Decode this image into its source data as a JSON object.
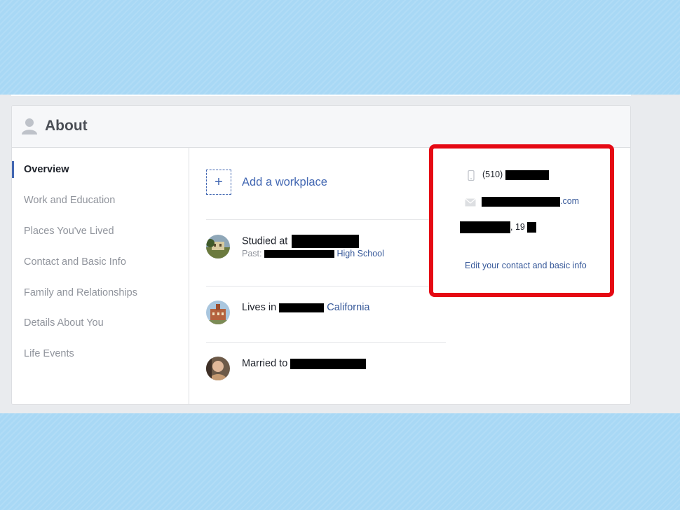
{
  "page": {
    "colors": {
      "accent": "#4267b2",
      "link": "#365899",
      "highlight_box": "#e50914",
      "background": "#a8d8f5"
    }
  },
  "about": {
    "title": "About",
    "icon": "person-icon"
  },
  "sidebar": {
    "items": [
      {
        "label": "Overview",
        "active": true
      },
      {
        "label": "Work and Education",
        "active": false
      },
      {
        "label": "Places You've Lived",
        "active": false
      },
      {
        "label": "Contact and Basic Info",
        "active": false
      },
      {
        "label": "Family and Relationships",
        "active": false
      },
      {
        "label": "Details About You",
        "active": false
      },
      {
        "label": "Life Events",
        "active": false
      }
    ]
  },
  "overview": {
    "add_workplace": {
      "icon": "plus-icon",
      "label": "Add a workplace"
    },
    "education": {
      "prefix": "Studied at",
      "sub_prefix": "Past:",
      "school_link": "High School"
    },
    "lives": {
      "prefix": "Lives in",
      "location_link": "California"
    },
    "married": {
      "prefix": "Married to"
    }
  },
  "contact": {
    "phone_icon": "phone-icon",
    "phone_prefix": "(510)",
    "email_icon": "envelope-icon",
    "email_suffix": ".com",
    "birthday_text": ", 19",
    "edit_link": "Edit your contact and basic info"
  }
}
